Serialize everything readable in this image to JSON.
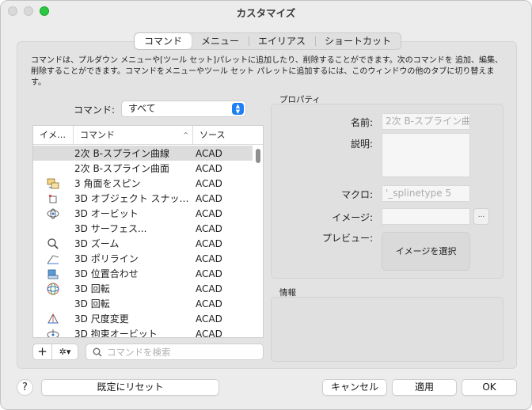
{
  "window": {
    "title": "カスタマイズ"
  },
  "tabs": [
    {
      "label": "コマンド",
      "active": true
    },
    {
      "label": "メニュー",
      "active": false
    },
    {
      "label": "エイリアス",
      "active": false
    },
    {
      "label": "ショートカット",
      "active": false
    }
  ],
  "description": "コマンドは、プルダウン メニューや[ツール セット]パレットに追加したり、削除することができます。次のコマンドを 追加、編集、削除することができます。コマンドをメニューやツール セット パレットに追加するには、このウィンドウの他のタブに切り替えます。",
  "filter": {
    "label": "コマンド:",
    "value": "すべて"
  },
  "list": {
    "headers": {
      "image": "イメ…",
      "command": "コマンド",
      "source": "ソース"
    },
    "rows": [
      {
        "icon": "none",
        "command": "2次 B-スプライン曲線",
        "source": "ACAD",
        "selected": true
      },
      {
        "icon": "none",
        "command": "2次 B-スプライン曲面",
        "source": "ACAD",
        "selected": false
      },
      {
        "icon": "spin-icon",
        "command": "3 角面をスピン",
        "source": "ACAD",
        "selected": false
      },
      {
        "icon": "object-snap-icon",
        "command": "3D オブジェクト スナッ…",
        "source": "ACAD",
        "selected": false
      },
      {
        "icon": "orbit-icon",
        "command": "3D オービット",
        "source": "ACAD",
        "selected": false
      },
      {
        "icon": "none",
        "command": "3D サーフェス...",
        "source": "ACAD",
        "selected": false
      },
      {
        "icon": "zoom-icon",
        "command": "3D ズーム",
        "source": "ACAD",
        "selected": false
      },
      {
        "icon": "polyline-icon",
        "command": "3D ポリライン",
        "source": "ACAD",
        "selected": false
      },
      {
        "icon": "align-icon",
        "command": "3D 位置合わせ",
        "source": "ACAD",
        "selected": false
      },
      {
        "icon": "rotate-icon",
        "command": "3D 回転",
        "source": "ACAD",
        "selected": false
      },
      {
        "icon": "none",
        "command": "3D 回転",
        "source": "ACAD",
        "selected": false
      },
      {
        "icon": "scale-icon",
        "command": "3D 尺度変更",
        "source": "ACAD",
        "selected": false
      },
      {
        "icon": "constrained-orbit-icon",
        "command": "3D 拘束オービット",
        "source": "ACAD",
        "selected": false
      }
    ]
  },
  "list_toolbar": {
    "add": "+",
    "gear": "✲▾"
  },
  "search": {
    "placeholder": "コマンドを検索",
    "value": ""
  },
  "properties": {
    "group_label": "プロパティ",
    "name_label": "名前:",
    "name_value": "2次 B-スプライン曲",
    "description_label": "説明:",
    "macro_label": "マクロ:",
    "macro_value": "'_splinetype 5",
    "image_label": "イメージ:",
    "browse": "...",
    "preview_label": "プレビュー:",
    "preview_button": "イメージを選択"
  },
  "info": {
    "group_label": "情報"
  },
  "footer": {
    "help": "?",
    "reset": "既定にリセット",
    "cancel": "キャンセル",
    "apply": "適用",
    "ok": "OK"
  },
  "colors": {
    "accent": "#1f7ff5",
    "zoom_button": "#2ac840",
    "selected_row": "#dcdcdc"
  }
}
